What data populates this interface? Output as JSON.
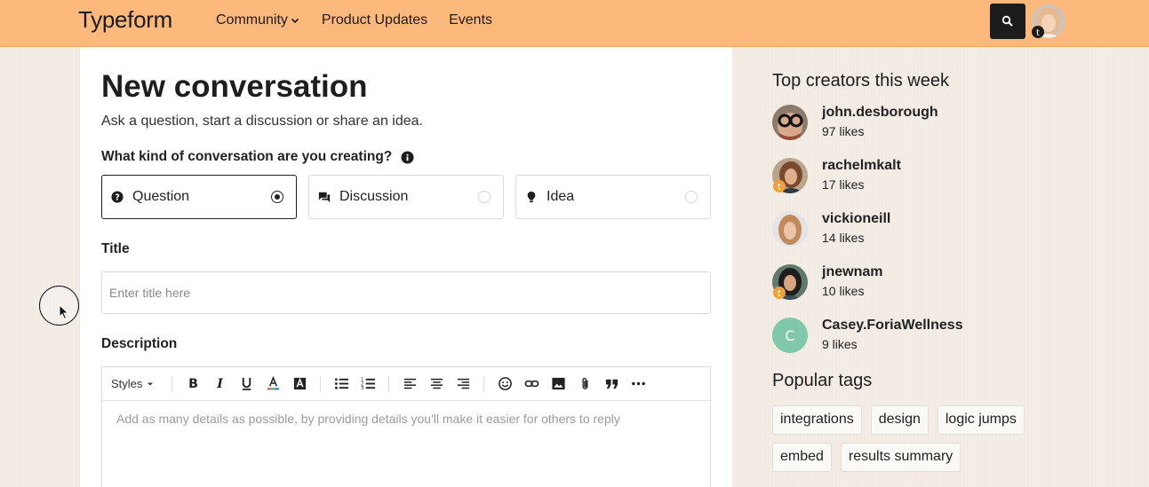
{
  "header": {
    "brand": "Typeform",
    "nav": [
      {
        "label": "Community",
        "has_dropdown": true
      },
      {
        "label": "Product Updates"
      },
      {
        "label": "Events"
      }
    ],
    "search_icon": "search-icon",
    "accent_color": "#fdb97b"
  },
  "form": {
    "title": "New conversation",
    "subtitle": "Ask a question, start a discussion or share an idea.",
    "kind_label": "What kind of conversation are you creating?",
    "types": [
      {
        "label": "Question",
        "icon": "question-circle-icon",
        "selected": true
      },
      {
        "label": "Discussion",
        "icon": "chat-bubbles-icon",
        "selected": false
      },
      {
        "label": "Idea",
        "icon": "lightbulb-icon",
        "selected": false
      }
    ],
    "title_label": "Title",
    "title_placeholder": "Enter title here",
    "description_label": "Description",
    "toolbar_styles": "Styles",
    "description_placeholder": "Add as many details as possible, by providing details you'll make it easier for others to reply"
  },
  "sidebar": {
    "creators_heading": "Top creators this week",
    "creators": [
      {
        "name": "john.desborough",
        "likes": "97 likes",
        "badge": false
      },
      {
        "name": "rachelmkalt",
        "likes": "17 likes",
        "badge": true
      },
      {
        "name": "vickioneill",
        "likes": "14 likes",
        "badge": false
      },
      {
        "name": "jnewnam",
        "likes": "10 likes",
        "badge": true
      },
      {
        "name": "Casey.ForiaWellness",
        "likes": "9 likes",
        "badge": false,
        "initial": "C"
      }
    ],
    "tags_heading": "Popular tags",
    "tags": [
      "integrations",
      "design",
      "logic jumps",
      "embed",
      "results summary"
    ]
  }
}
